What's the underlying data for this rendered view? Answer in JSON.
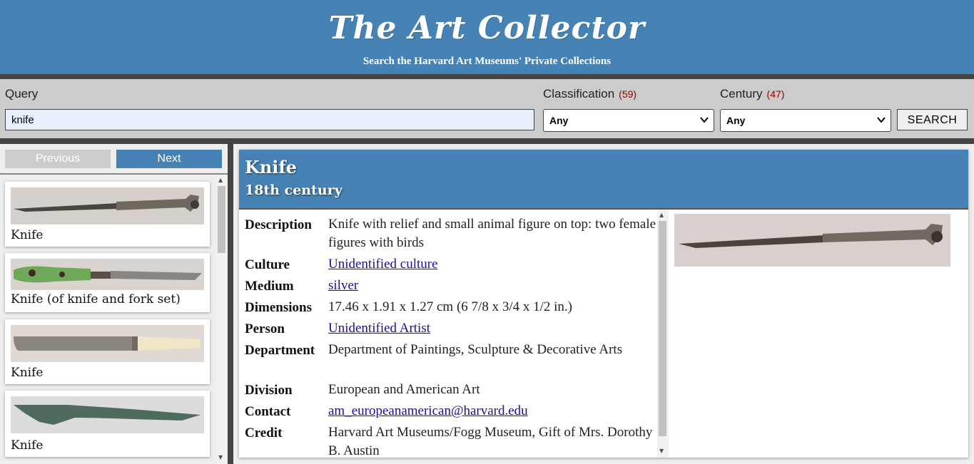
{
  "header": {
    "title": "The Art Collector",
    "subtitle": "Search the Harvard Art Museums' Private Collections"
  },
  "search": {
    "query_label": "Query",
    "query_value": "knife",
    "classification_label": "Classification",
    "classification_count": "(59)",
    "classification_value": "Any",
    "century_label": "Century",
    "century_count": "(47)",
    "century_value": "Any",
    "search_button": "SEARCH"
  },
  "pagination": {
    "previous": "Previous",
    "next": "Next"
  },
  "results": [
    {
      "title": "Knife"
    },
    {
      "title": "Knife (of knife and fork set)"
    },
    {
      "title": "Knife"
    },
    {
      "title": "Knife"
    }
  ],
  "detail": {
    "title": "Knife",
    "dated": "18th century",
    "facts": [
      {
        "label": "Description",
        "value": "Knife with relief and small animal figure on top: two female figures with birds",
        "link": false
      },
      {
        "label": "Culture",
        "value": "Unidentified culture",
        "link": true
      },
      {
        "label": "Medium",
        "value": "silver",
        "link": true
      },
      {
        "label": "Dimensions",
        "value": "17.46 x 1.91 x 1.27 cm (6 7/8 x 3/4 x 1/2 in.)",
        "link": false
      },
      {
        "label": "Person",
        "value": "Unidentified Artist",
        "link": true
      },
      {
        "label": "Department",
        "value": "Department of Paintings, Sculpture & Decorative Arts",
        "link": false
      },
      {
        "label": "Division",
        "value": "European and American Art",
        "link": false
      },
      {
        "label": "Contact",
        "value": "am_europeanamerican@harvard.edu",
        "link": true
      },
      {
        "label": "Credit",
        "value": "Harvard Art Museums/Fogg Museum, Gift of Mrs. Dorothy B. Austin",
        "link": false
      }
    ]
  },
  "colors": {
    "brand": "#4682b4",
    "count": "#8b0000",
    "link": "#1a0dab"
  },
  "icons": {
    "select_chevron": "chevron-down-icon",
    "scroll_up": "arrow-up-icon",
    "scroll_down": "arrow-down-icon"
  }
}
